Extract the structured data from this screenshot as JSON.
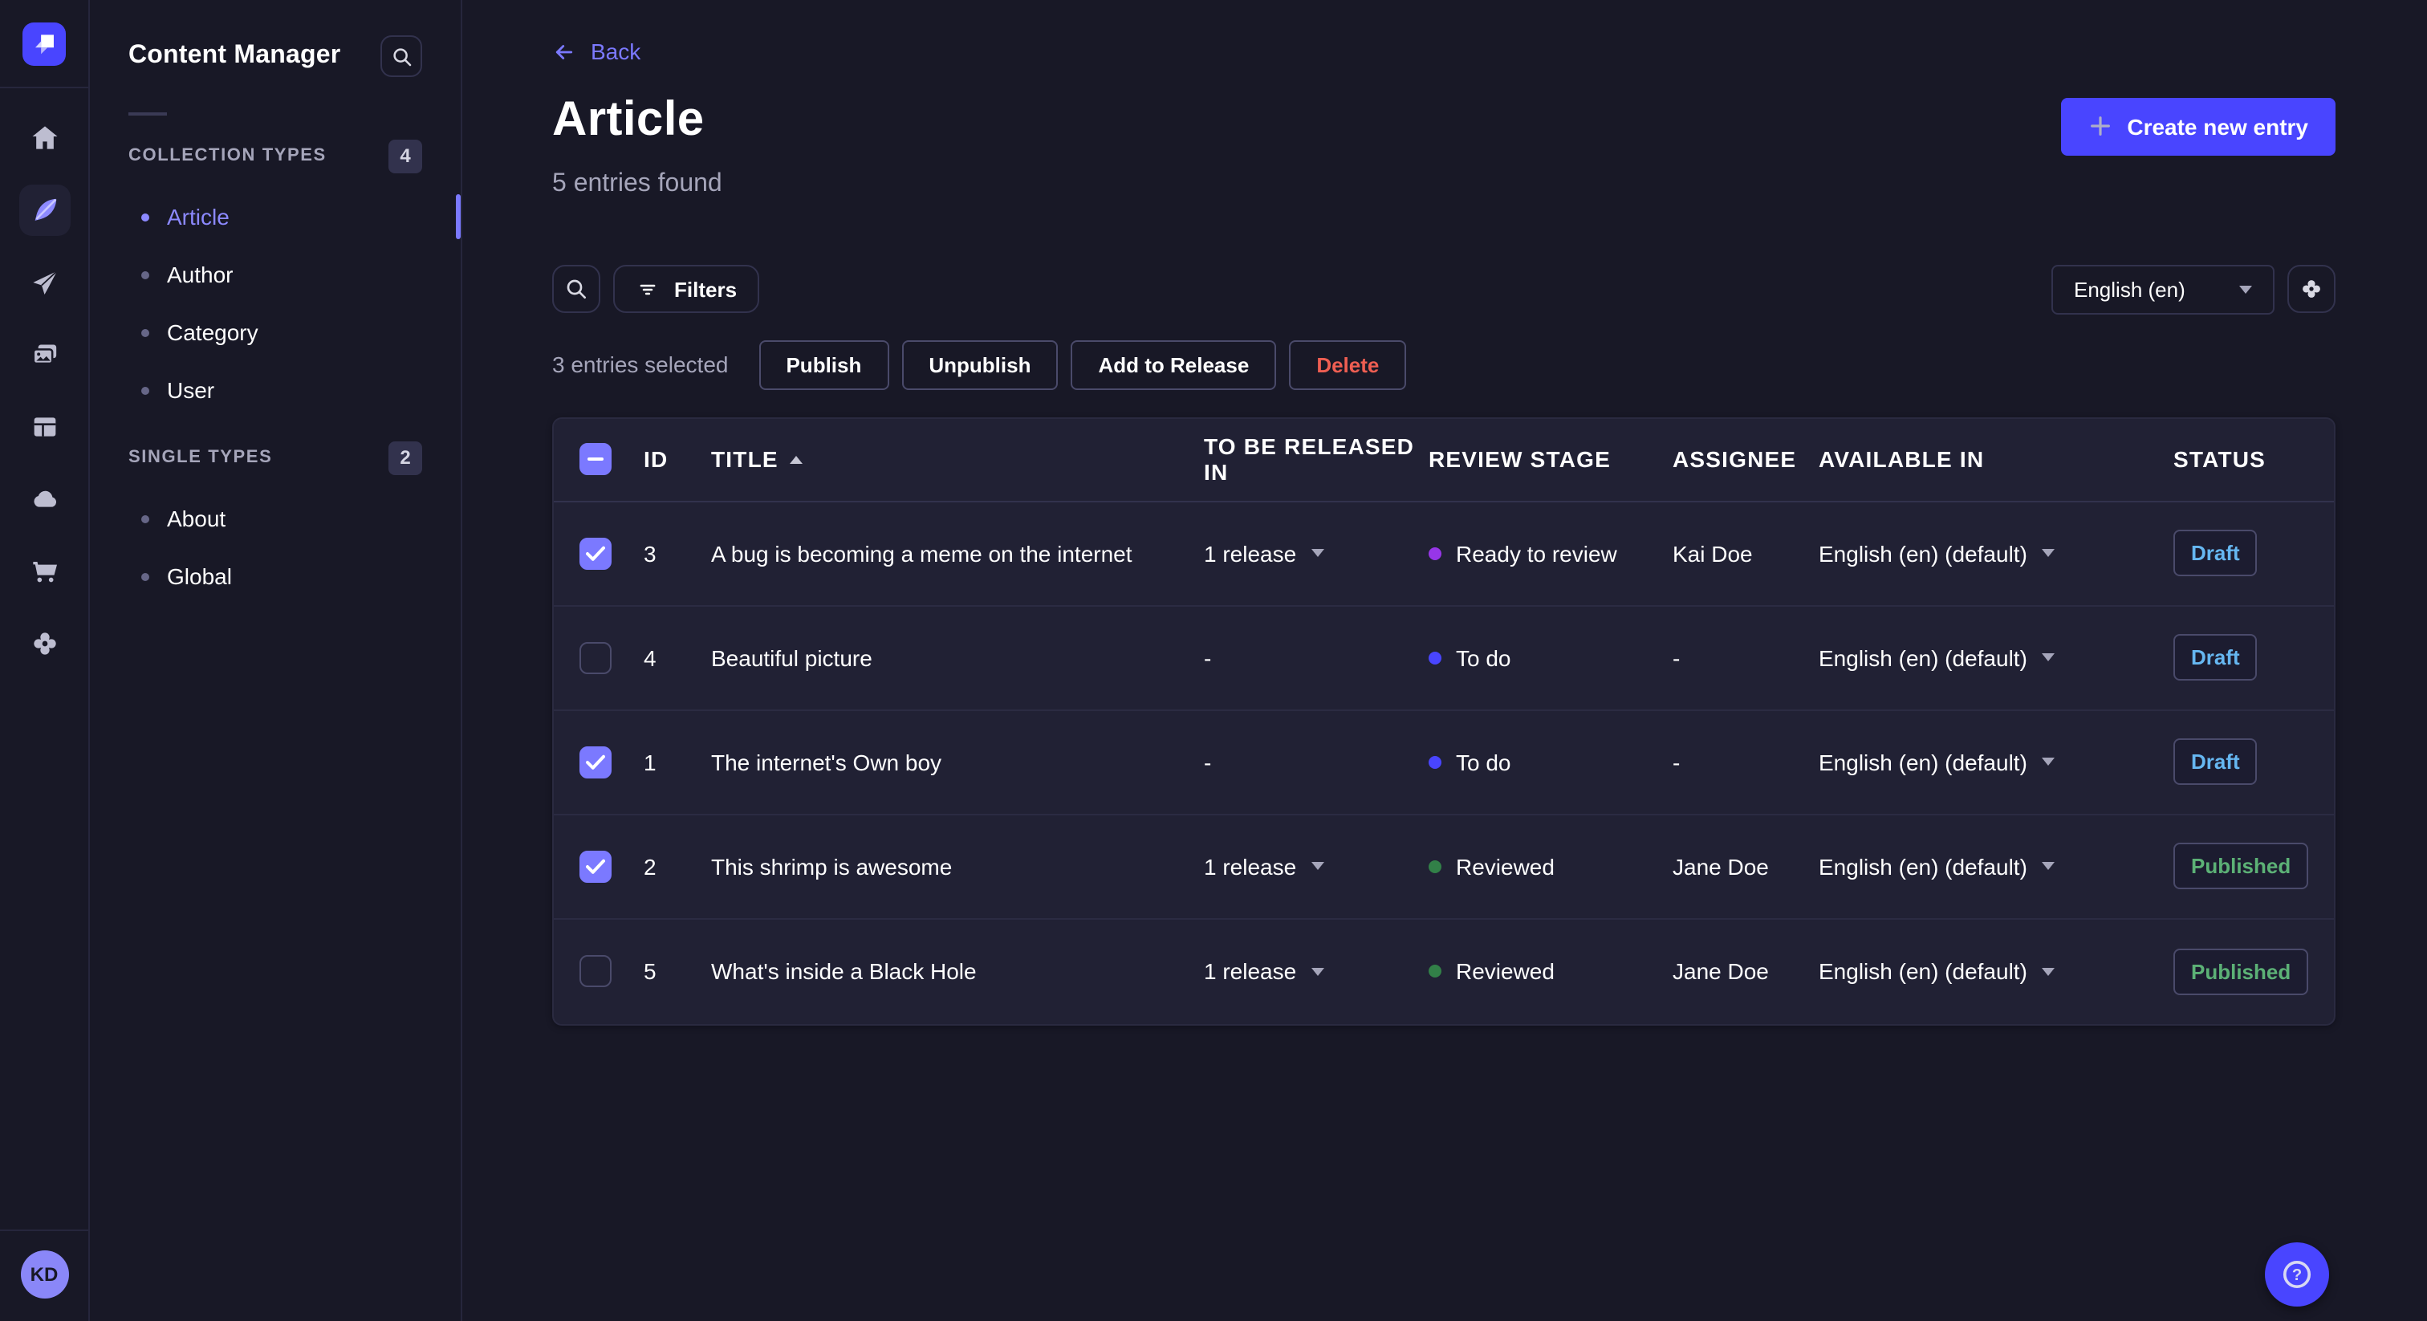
{
  "rail": {
    "logo_icon": "strapi-logo",
    "items": [
      {
        "icon": "home-icon",
        "active": false
      },
      {
        "icon": "feather-content-manager-icon",
        "active": true
      },
      {
        "icon": "paper-plane-releases-icon",
        "active": false
      },
      {
        "icon": "media-library-icon",
        "active": false
      },
      {
        "icon": "content-type-builder-icon",
        "active": false
      },
      {
        "icon": "cloud-deploy-icon",
        "active": false
      },
      {
        "icon": "marketplace-cart-icon",
        "active": false
      },
      {
        "icon": "settings-gear-icon",
        "active": false
      }
    ],
    "avatar_initials": "KD"
  },
  "sidebar": {
    "title": "Content Manager",
    "search_icon": "search-icon",
    "sections": [
      {
        "label": "COLLECTION TYPES",
        "badge": "4",
        "items": [
          {
            "label": "Article",
            "active": true
          },
          {
            "label": "Author",
            "active": false
          },
          {
            "label": "Category",
            "active": false
          },
          {
            "label": "User",
            "active": false
          }
        ]
      },
      {
        "label": "SINGLE TYPES",
        "badge": "2",
        "items": [
          {
            "label": "About",
            "active": false
          },
          {
            "label": "Global",
            "active": false
          }
        ]
      }
    ]
  },
  "header": {
    "back_label": "Back",
    "title": "Article",
    "subtitle": "5 entries found",
    "create_button_label": "Create new entry"
  },
  "toolbar": {
    "search_icon": "search-icon",
    "filters_label": "Filters",
    "locale_select_value": "English (en)",
    "settings_icon": "gear-icon"
  },
  "selection": {
    "count_label": "3 entries selected",
    "publish_label": "Publish",
    "unpublish_label": "Unpublish",
    "add_to_release_label": "Add to Release",
    "delete_label": "Delete"
  },
  "table": {
    "headers": [
      "ID",
      "TITLE",
      "TO BE RELEASED IN",
      "REVIEW STAGE",
      "ASSIGNEE",
      "AVAILABLE IN",
      "STATUS"
    ],
    "sorted_column": "TITLE",
    "sort_direction": "asc",
    "rows": [
      {
        "checked": true,
        "id": "3",
        "title": "A bug is becoming a meme on the internet",
        "to_be_released_in": "1 release",
        "release_dropdown": true,
        "review_stage": "Ready to review",
        "stage_color": "#9736e8",
        "assignee": "Kai Doe",
        "available_in": "English (en) (default)",
        "status": "Draft"
      },
      {
        "checked": false,
        "id": "4",
        "title": "Beautiful picture",
        "to_be_released_in": "-",
        "release_dropdown": false,
        "review_stage": "To do",
        "stage_color": "#4945ff",
        "assignee": "-",
        "available_in": "English (en) (default)",
        "status": "Draft"
      },
      {
        "checked": true,
        "id": "1",
        "title": "The internet's Own boy",
        "to_be_released_in": "-",
        "release_dropdown": false,
        "review_stage": "To do",
        "stage_color": "#4945ff",
        "assignee": "-",
        "available_in": "English (en) (default)",
        "status": "Draft"
      },
      {
        "checked": true,
        "id": "2",
        "title": "This shrimp is awesome",
        "to_be_released_in": "1 release",
        "release_dropdown": true,
        "review_stage": "Reviewed",
        "stage_color": "#328048",
        "assignee": "Jane Doe",
        "available_in": "English (en) (default)",
        "status": "Published"
      },
      {
        "checked": false,
        "id": "5",
        "title": "What's inside a Black Hole",
        "to_be_released_in": "1 release",
        "release_dropdown": true,
        "review_stage": "Reviewed",
        "stage_color": "#328048",
        "assignee": "Jane Doe",
        "available_in": "English (en) (default)",
        "status": "Published"
      }
    ]
  },
  "misc": {
    "help_icon": "help-question-icon"
  },
  "colors": {
    "accent": "#4945ff",
    "accent_light": "#7b79ff",
    "page_bg": "#181826",
    "panel_bg": "#212134",
    "border": "#32324d",
    "text_muted": "#a5a5ba",
    "status_draft": "#66b7f1",
    "status_published": "#5cb176",
    "danger": "#ee5e52",
    "stage_ready_to_review": "#9736e8",
    "stage_to_do": "#4945ff",
    "stage_reviewed": "#328048"
  }
}
